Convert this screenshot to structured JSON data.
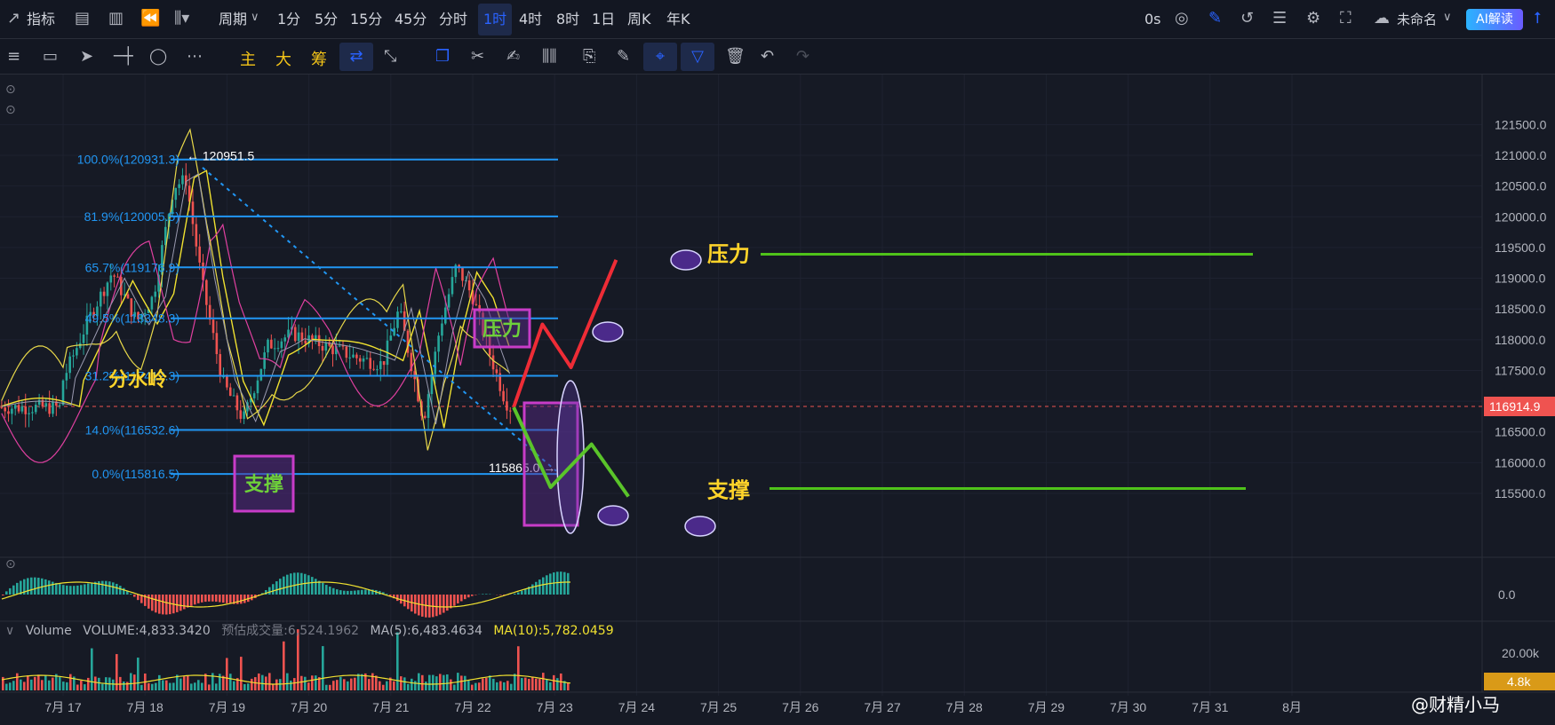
{
  "topbar": {
    "indicator_label": "指标",
    "period_label": "周期",
    "timeframes": [
      "1分",
      "5分",
      "15分",
      "45分",
      "分时",
      "1时",
      "4时",
      "8时",
      "1日",
      "周K",
      "年K"
    ],
    "active_timeframe": "1时",
    "countdown": "0s",
    "layout_name": "未命名",
    "ai_button": "AI解读"
  },
  "toolbar2": {
    "main_label": "主",
    "big_label": "大",
    "chip_label": "筹"
  },
  "chart_data": [
    {
      "type": "candlestick",
      "x_categories": [
        "7月 17",
        "7月 18",
        "7月 19",
        "7月 20",
        "7月 21",
        "7月 22",
        "7月 23",
        "7月 24",
        "7月 25",
        "7月 26",
        "7月 27",
        "7月 28",
        "7月 29",
        "7月 30",
        "7月 31",
        "8月"
      ],
      "y_ticks": [
        "121500.0",
        "121000.0",
        "120500.0",
        "120000.0",
        "119500.0",
        "119000.0",
        "118500.0",
        "118000.0",
        "117500.0",
        "117000.0",
        "116500.0",
        "116000.0",
        "115500.0"
      ],
      "ylim": [
        115200,
        121900
      ],
      "last_price": "116914.9",
      "last_price_value": 116914.9,
      "high_label": "120951.5",
      "low_label": "115865.0",
      "fibonacci": [
        {
          "label": "100.0%(120931.3)",
          "value": 120931.3
        },
        {
          "label": "81.9%(120005.5)",
          "value": 120005.5
        },
        {
          "label": "65.7%(119176.9)",
          "value": 119176.9
        },
        {
          "label": "49.5%(118348.3)",
          "value": 118348.3
        },
        {
          "label": "31.2%(117412.3)",
          "value": 117412.3
        },
        {
          "label": "14.0%(116532.6)",
          "value": 116532.6
        },
        {
          "label": "0.0%(115816.5)",
          "value": 115816.5
        }
      ],
      "projection_up": [
        [
          22.5,
          116900
        ],
        [
          22.85,
          118250
        ],
        [
          23.2,
          117550
        ],
        [
          23.75,
          119300
        ]
      ],
      "projection_down": [
        [
          22.5,
          116900
        ],
        [
          22.95,
          115600
        ],
        [
          23.45,
          116300
        ],
        [
          23.9,
          115450
        ]
      ],
      "resistance_level": 119390,
      "support_level": 115580,
      "annotations": {
        "watershed": "分水岭",
        "resistance_box": "压力",
        "support_box": "支撑",
        "resistance": "压力",
        "support": "支撑"
      },
      "colors": {
        "up": "#26a69a",
        "down": "#ef5350",
        "fib": "#2196f3",
        "ma_yellow": "#f0e130",
        "band_pink": "#e040a0",
        "proj_up": "#ee2c36",
        "proj_down": "#5ac42a",
        "level_line": "#4fc21a",
        "box": "#c83cc8",
        "marker_fill": "#4b2a8a",
        "annotation_yellow": "#ffd42a"
      }
    },
    {
      "type": "macd",
      "zero_label": "0.0"
    },
    {
      "type": "bar",
      "name": "Volume",
      "volume": "VOLUME:4,833.3420",
      "estimated": "预估成交量:6,524.1962",
      "ma5": "MA(5):6,483.4634",
      "ma10": "MA(10):5,782.0459",
      "ytick": "20.00k",
      "current_badge": "4.8k"
    }
  ],
  "watermark": "@财精小马"
}
